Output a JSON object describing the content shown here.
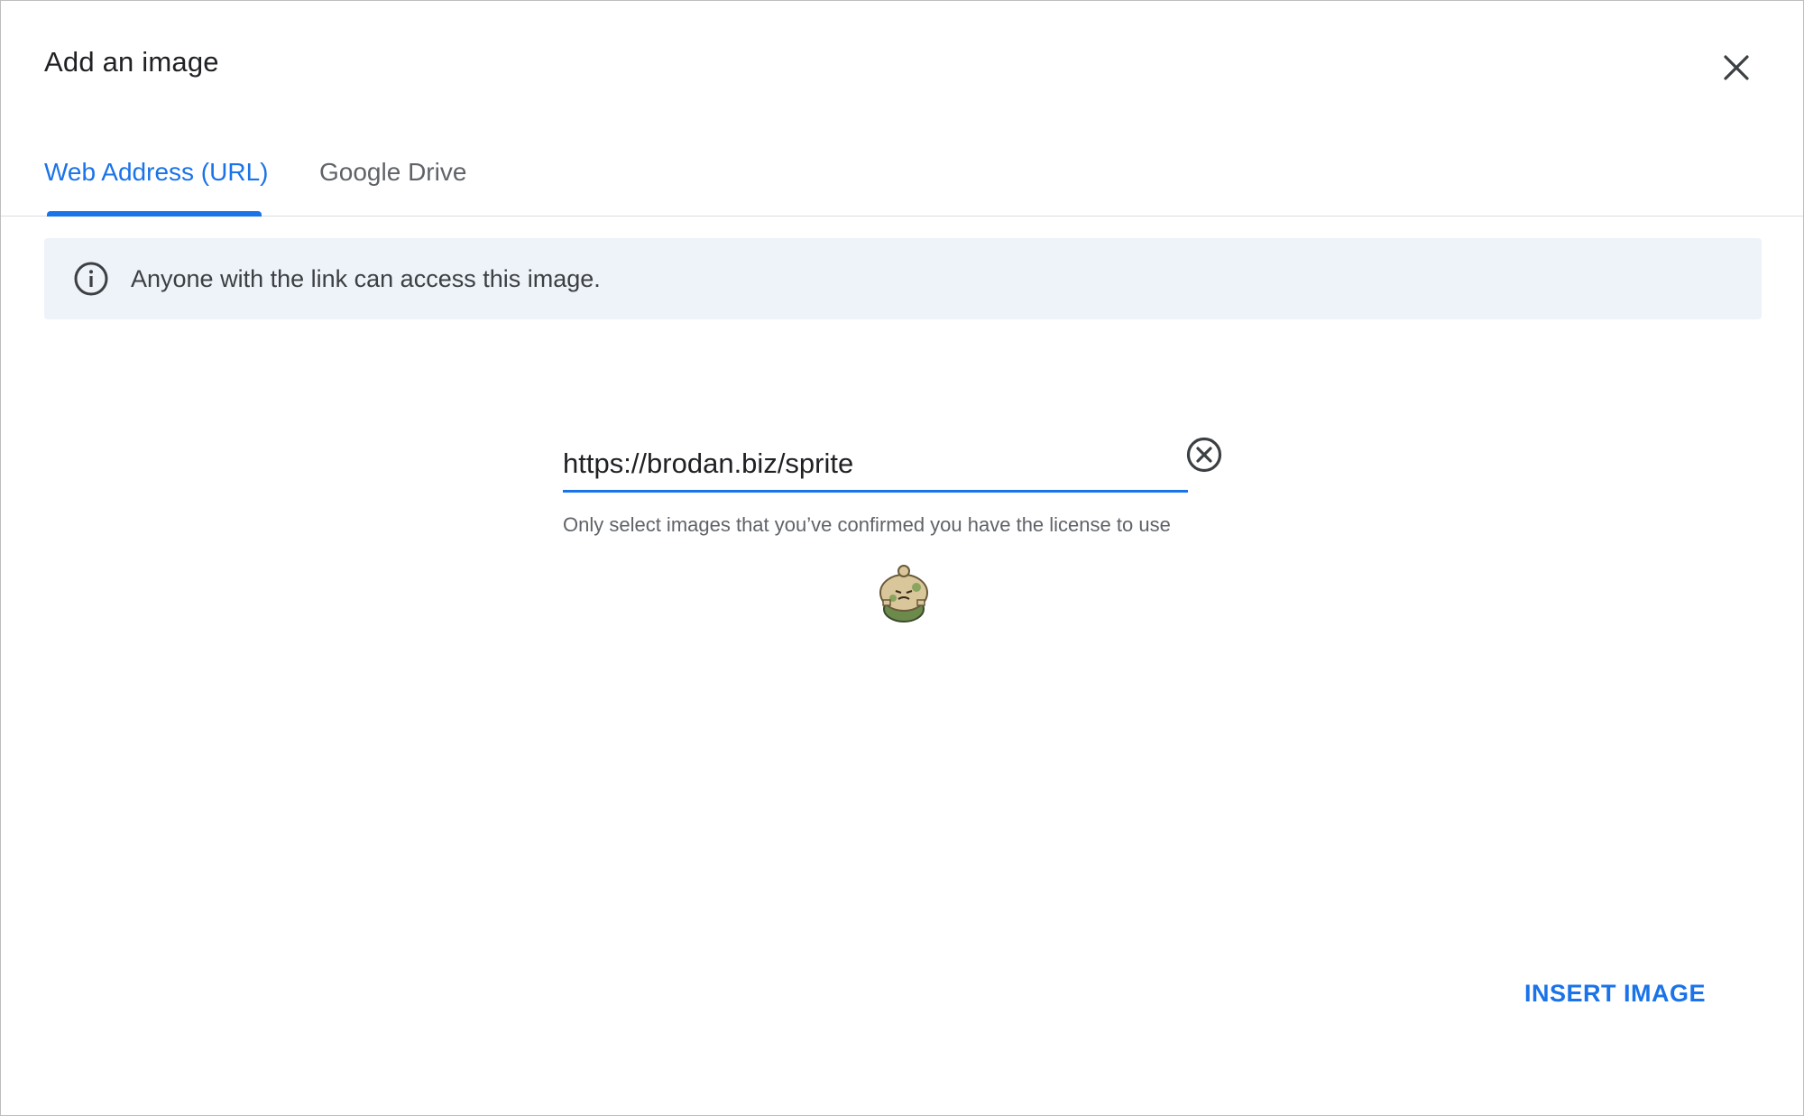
{
  "dialog": {
    "title": "Add an image",
    "close_icon": "close-icon"
  },
  "tabs": [
    {
      "label": "Web Address (URL)",
      "active": true
    },
    {
      "label": "Google Drive",
      "active": false
    }
  ],
  "notice": {
    "icon": "info-icon",
    "text": "Anyone with the link can access this image."
  },
  "url_field": {
    "value": "https://brodan.biz/sprite",
    "clear_icon": "clear-circle-icon"
  },
  "helper_text": "Only select images that you’ve confirmed you have the license to use",
  "preview": {
    "icon": "sprite-preview-image"
  },
  "actions": {
    "insert_label": "INSERT IMAGE"
  },
  "colors": {
    "accent": "#1a73e8",
    "notice_bg": "#eef2f9",
    "text_primary": "#202124",
    "text_secondary": "#5f6368"
  }
}
